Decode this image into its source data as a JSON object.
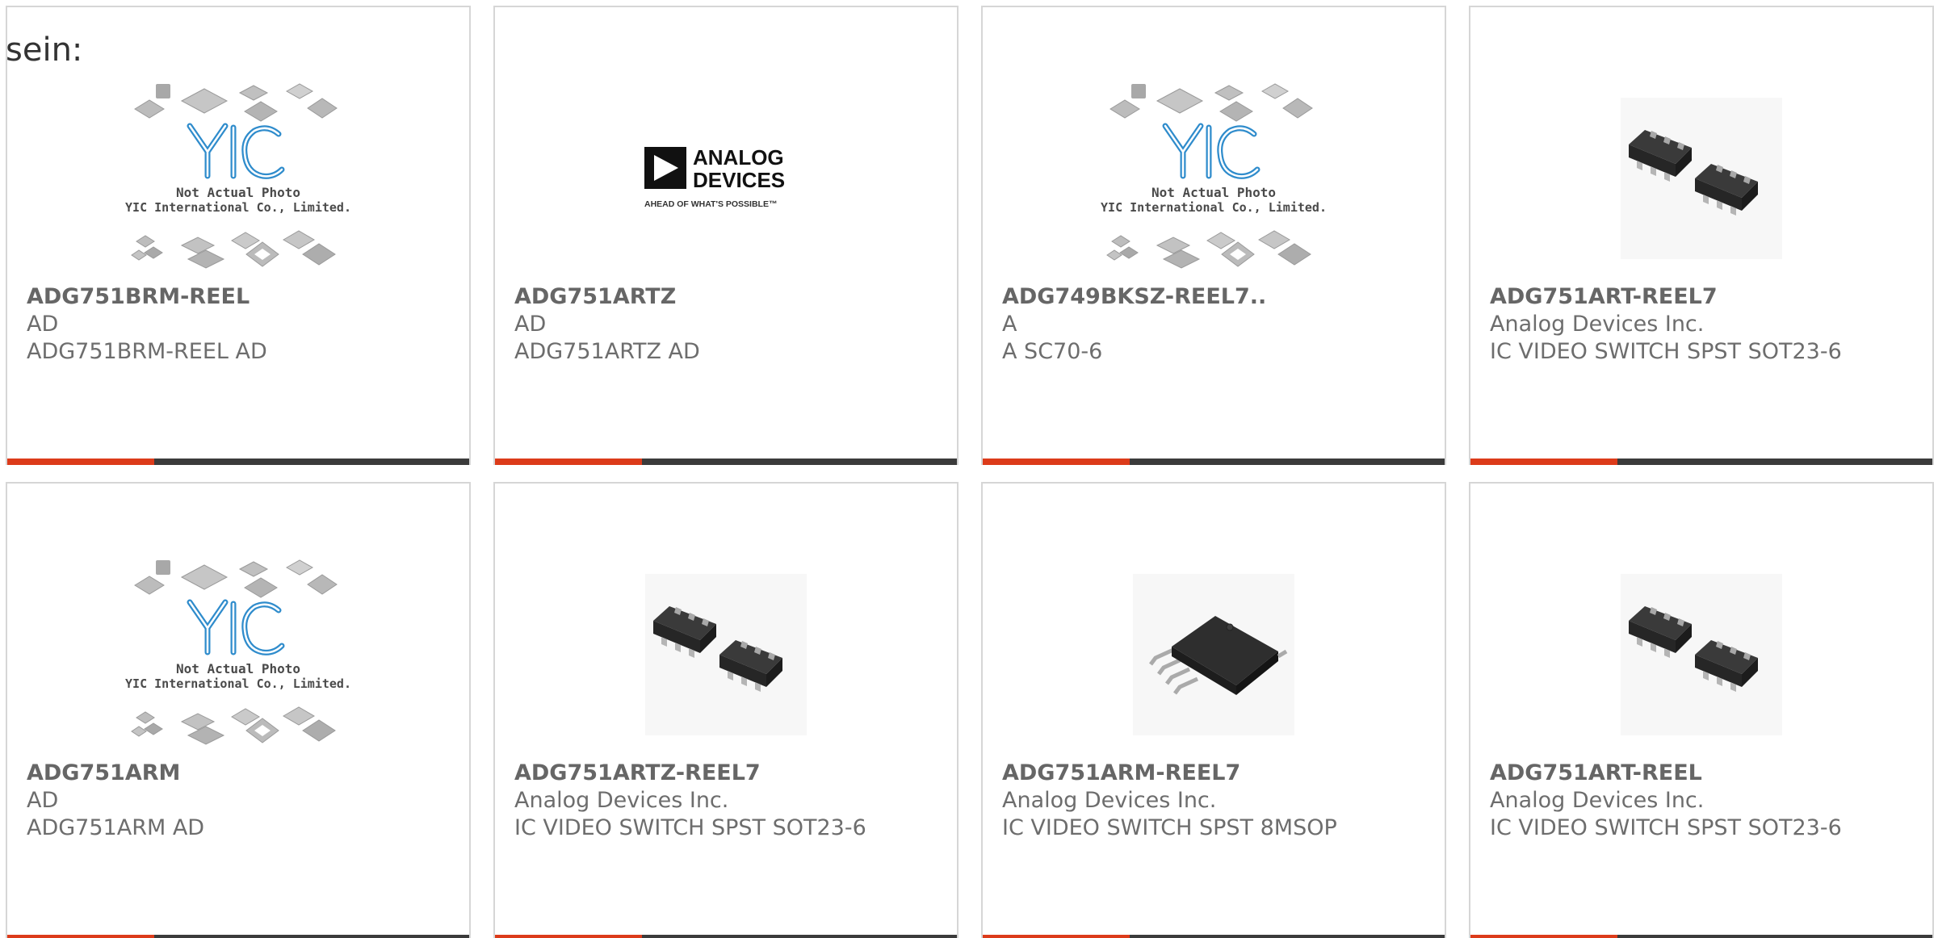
{
  "intro_text": "sein:",
  "products": [
    {
      "part": "ADG751BRM-REEL",
      "manufacturer": "AD",
      "description": "ADG751BRM-REEL AD",
      "image": "yic-placeholder"
    },
    {
      "part": "ADG751ARTZ",
      "manufacturer": "AD",
      "description": "ADG751ARTZ AD",
      "image": "analog-devices-logo"
    },
    {
      "part": "ADG749BKSZ-REEL7..",
      "manufacturer": "A",
      "description": "A SC70-6",
      "image": "yic-placeholder"
    },
    {
      "part": "ADG751ART-REEL7",
      "manufacturer": "Analog Devices Inc.",
      "description": "IC VIDEO SWITCH SPST SOT23-6",
      "image": "sot23-6-package"
    },
    {
      "part": "ADG751ARM",
      "manufacturer": "AD",
      "description": "ADG751ARM AD",
      "image": "yic-placeholder"
    },
    {
      "part": "ADG751ARTZ-REEL7",
      "manufacturer": "Analog Devices Inc.",
      "description": "IC VIDEO SWITCH SPST SOT23-6",
      "image": "sot23-6-package"
    },
    {
      "part": "ADG751ARM-REEL7",
      "manufacturer": "Analog Devices Inc.",
      "description": "IC VIDEO SWITCH SPST 8MSOP",
      "image": "msop-8-package"
    },
    {
      "part": "ADG751ART-REEL",
      "manufacturer": "Analog Devices Inc.",
      "description": "IC VIDEO SWITCH SPST SOT23-6",
      "image": "sot23-6-package"
    }
  ],
  "placeholder_caption": {
    "line1": "Not Actual Photo",
    "line2": "YIC International Co., Limited."
  },
  "brand_logo": {
    "name_line1": "ANALOG",
    "name_line2": "DEVICES",
    "tagline": "AHEAD OF WHAT'S POSSIBLE™"
  },
  "colors": {
    "accent": "#dc3b1a",
    "bar": "#3b3b3b",
    "card_border": "#d6d6d6",
    "text": "#6d6d6d",
    "yic_blue": "#2f8ccc"
  }
}
